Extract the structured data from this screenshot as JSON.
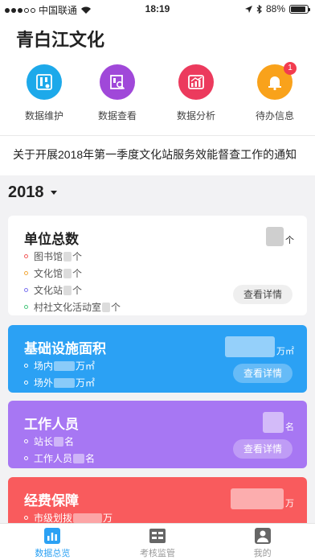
{
  "status": {
    "carrier": "中国联通",
    "time": "18:19",
    "battery": "88%",
    "battery_level": 0.88
  },
  "app": {
    "title": "青白江文化"
  },
  "features": [
    {
      "label": "数据维护",
      "icon": "database-maintenance-icon",
      "color": "#1da9ea"
    },
    {
      "label": "数据查看",
      "icon": "data-view-icon",
      "color": "#a048d9"
    },
    {
      "label": "数据分析",
      "icon": "analytics-icon",
      "color": "#ec3a5d"
    },
    {
      "label": "待办信息",
      "icon": "bell-icon",
      "color": "#f9a21b",
      "badge": "1"
    }
  ],
  "notice": "关于开展2018年第一季度文化站服务效能督查工作的通知",
  "year_selector": {
    "year": "2018"
  },
  "cards": {
    "units": {
      "title": "单位总数",
      "total_unit": "个",
      "button": "查看详情",
      "items": [
        {
          "label": "图书馆",
          "unit": "个",
          "dot": "#f25b5b"
        },
        {
          "label": "文化馆",
          "unit": "个",
          "dot": "#f1a93b"
        },
        {
          "label": "文化站",
          "unit": "个",
          "dot": "#7b72f0"
        },
        {
          "label": "村社文化活动室",
          "unit": "个",
          "dot": "#48c77c"
        }
      ]
    },
    "facilities": {
      "title": "基础设施面积",
      "total_unit": "万㎡",
      "button": "查看详情",
      "color": "#2ba1f4",
      "items": [
        {
          "label": "场内",
          "unit": "万㎡"
        },
        {
          "label": "场外",
          "unit": "万㎡"
        }
      ]
    },
    "staff": {
      "title": "工作人员",
      "total_unit": "名",
      "button": "查看详情",
      "color": "#a777f3",
      "items": [
        {
          "label": "站长",
          "unit": "名"
        },
        {
          "label": "工作人员",
          "unit": "名"
        }
      ]
    },
    "funding": {
      "title": "经费保障",
      "total_unit": "万",
      "color": "#f95b5d",
      "items": [
        {
          "label": "市级划拨",
          "unit": "万"
        }
      ]
    }
  },
  "tabs": [
    {
      "label": "数据总览",
      "icon": "chart-icon",
      "active": true
    },
    {
      "label": "考核监管",
      "icon": "calendar-icon",
      "active": false
    },
    {
      "label": "我的",
      "icon": "user-icon",
      "active": false
    }
  ]
}
